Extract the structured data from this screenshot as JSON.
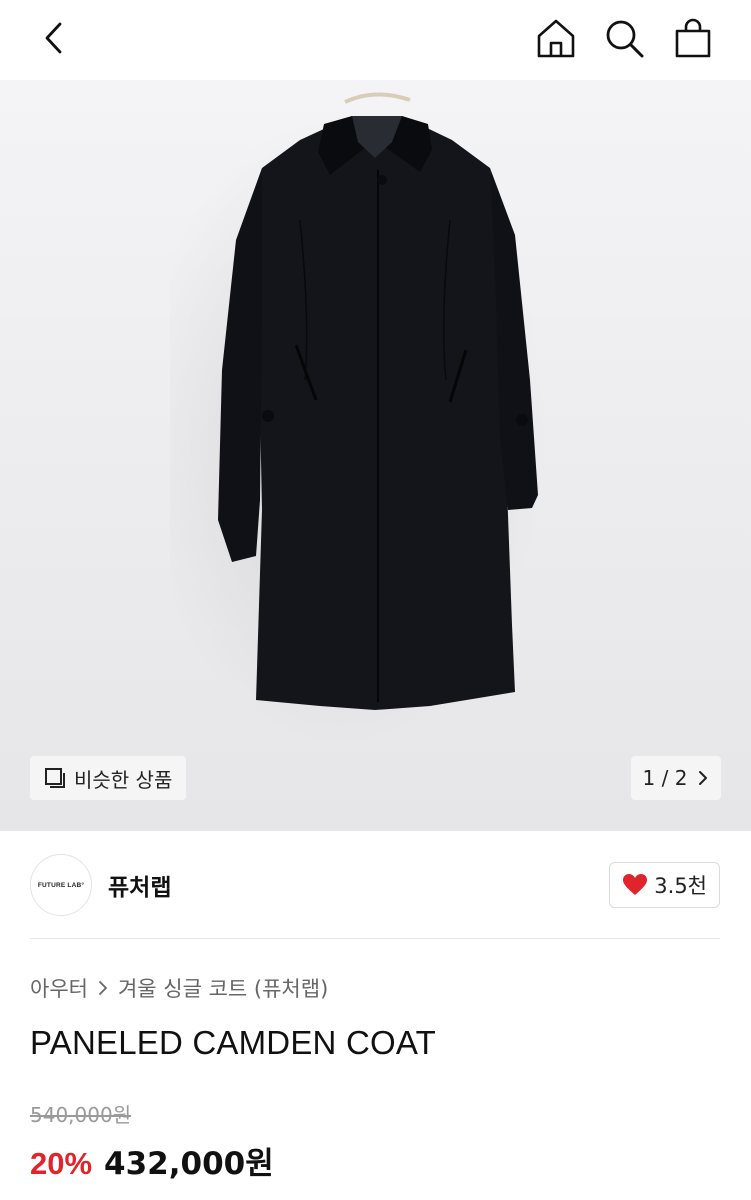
{
  "icons": {
    "back": "chevron-left-icon",
    "home": "home-icon",
    "search": "search-icon",
    "bag": "shopping-bag-icon",
    "similar": "similar-items-icon",
    "pager_next": "chevron-right-icon",
    "heart": "heart-icon",
    "breadcrumb_sep": "chevron-right-icon"
  },
  "gallery": {
    "similar_label": "비슷한 상품",
    "page_indicator": "1 / 2"
  },
  "brand": {
    "logo_text": "FUTURE LAB°",
    "name": "퓨처랩",
    "likes": "3.5천",
    "heart_color": "#e0242b"
  },
  "product": {
    "breadcrumb": [
      "아우터",
      "겨울 싱글 코트 (퓨처랩)"
    ],
    "title": "PANELED CAMDEN COAT",
    "original_price": "540,000원",
    "discount": "20%",
    "sale_price": "432,000원",
    "discount_color": "#e0242b"
  }
}
